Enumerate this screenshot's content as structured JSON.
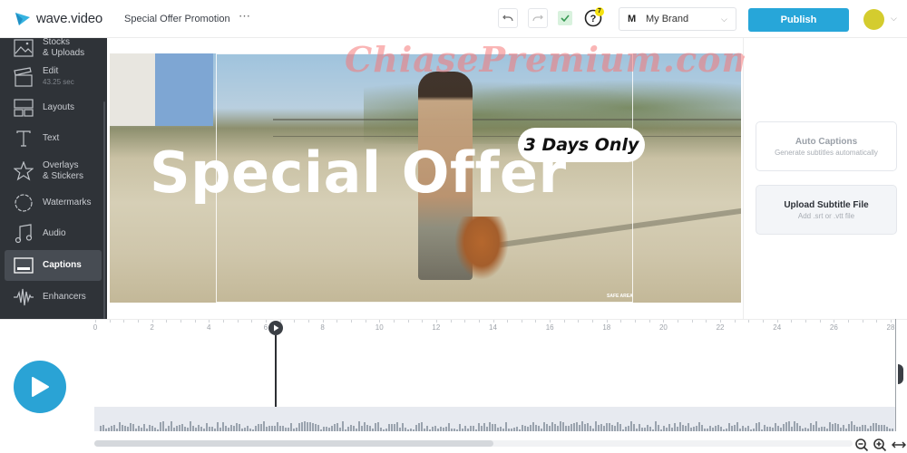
{
  "header": {
    "logo_text": "wave.video",
    "project_title": "Special Offer Promotion",
    "more_icon": "⋯",
    "help_badge_count": "7",
    "brand_letter": "M",
    "brand_name": "My Brand",
    "publish_label": "Publish"
  },
  "sidebar": {
    "items": [
      {
        "label": "Stocks",
        "label2": "& Uploads",
        "icon": "image-icon"
      },
      {
        "label": "Edit",
        "sub": "43.25 sec",
        "icon": "clapperboard-icon"
      },
      {
        "label": "Layouts",
        "icon": "layout-icon"
      },
      {
        "label": "Text",
        "icon": "text-icon"
      },
      {
        "label": "Overlays",
        "label2": "& Stickers",
        "icon": "star-icon"
      },
      {
        "label": "Watermarks",
        "icon": "watermark-icon"
      },
      {
        "label": "Audio",
        "icon": "music-note-icon"
      },
      {
        "label": "Captions",
        "icon": "captions-icon",
        "active": true
      },
      {
        "label": "Enhancers",
        "icon": "waveform-icon"
      }
    ]
  },
  "canvas": {
    "headline": "Special Offer",
    "badge": "3 Days Only",
    "safe_area_label": "SAFE AREA",
    "watermark": "ChiasePremium.com"
  },
  "captions_panel": {
    "auto": {
      "title": "Auto Captions",
      "subtitle": "Generate subtitles automatically"
    },
    "upload": {
      "title": "Upload Subtitle File",
      "subtitle": "Add .srt or .vtt file"
    }
  },
  "timeline": {
    "ticks": [
      "0",
      "2",
      "4",
      "6",
      "8",
      "10",
      "12",
      "14",
      "16",
      "18",
      "20",
      "22",
      "24",
      "26",
      "28"
    ],
    "playhead_seconds": 6.3,
    "duration_seconds": 28,
    "scroll_position": 0.53
  },
  "colors": {
    "accent": "#27a6d9",
    "sidebar_bg": "#2f3338",
    "avatar": "#d4cc2e"
  }
}
